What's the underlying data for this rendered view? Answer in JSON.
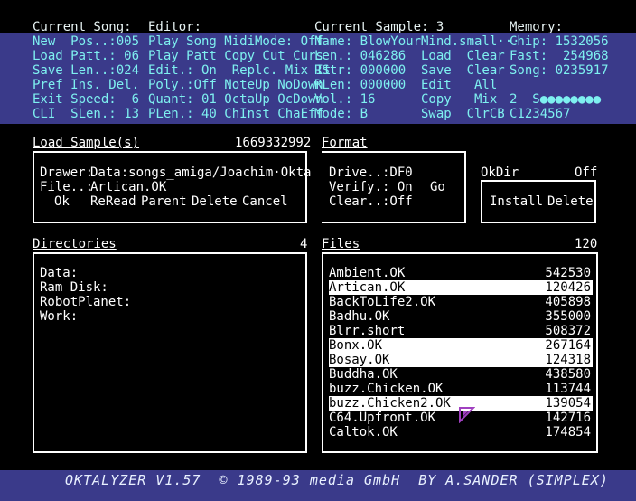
{
  "header": {
    "rows": [
      [
        "Current Song:",
        "Editor:",
        "Current Sample: 3",
        "Memory:"
      ],
      [
        "New  Pos..:005",
        "Play Song MidiMode: Off",
        "Name: BlowYourMind.small···",
        "Chip: 1532056"
      ],
      [
        "Load Patt.: 06",
        "Play Patt Copy Cut Curs",
        "Len.: 046286  Load  Clear",
        "Fast:  254968"
      ],
      [
        "Save Len..:024",
        "Edit.: On  Replc. Mix It",
        "RStr: 000000  Save  Clear",
        "Song: 0235917"
      ],
      [
        "Pref Ins. Del.",
        "Poly.:Off NoteUp NoDown",
        "RLen: 000000  Edit   All",
        ""
      ],
      [
        "Exit Speed:  6",
        "Quant: 01 OctaUp OcDown",
        "Vol.: 16      Copy   Mix",
        "2  S●●●●●●●●"
      ],
      [
        "CLI  SLen.: 13",
        "PLen.: 40 ChInst ChaEff",
        "Mode: B       Swap  ClrCB",
        "C1234567"
      ]
    ]
  },
  "load_sample": {
    "title": "Load Sample(s)",
    "free": "1669332992",
    "drawer_label": "Drawer:",
    "drawer_value": "Data:songs_amiga/Joachim·Okta",
    "file_label": "File..:",
    "file_value": "Artican.OK",
    "buttons": [
      "Ok",
      "ReRead",
      "Parent",
      "Delete",
      "Cancel"
    ]
  },
  "format": {
    "title": "Format",
    "drive": "Drive..:DF0",
    "verify": "Verify.: On",
    "clear": "Clear..:Off",
    "go": "Go"
  },
  "okdir": {
    "label": "OkDir",
    "value": "Off",
    "install": "Install",
    "delete": "Delete"
  },
  "directories": {
    "title": "Directories",
    "count": "4",
    "items": [
      "Data:",
      "Ram Disk:",
      "RobotPlanet:",
      "Work:"
    ]
  },
  "files": {
    "title": "Files",
    "count": "120",
    "items": [
      {
        "name": "Ambient.OK",
        "size": "542530",
        "selected": false
      },
      {
        "name": "Artican.OK",
        "size": "120426",
        "selected": true
      },
      {
        "name": "BackToLife2.OK",
        "size": "405898",
        "selected": false
      },
      {
        "name": "Badhu.OK",
        "size": "355000",
        "selected": false
      },
      {
        "name": "Blrr.short",
        "size": "508372",
        "selected": false
      },
      {
        "name": "Bonx.OK",
        "size": "267164",
        "selected": true
      },
      {
        "name": "Bosay.OK",
        "size": "124318",
        "selected": true
      },
      {
        "name": "Buddha.OK",
        "size": "438580",
        "selected": false
      },
      {
        "name": "buzz.Chicken.OK",
        "size": "113744",
        "selected": false
      },
      {
        "name": "buzz.Chicken2.OK",
        "size": "139054",
        "selected": true
      },
      {
        "name": "C64.Upfront.OK",
        "size": "142716",
        "selected": false
      },
      {
        "name": "Caltok.OK",
        "size": "174854",
        "selected": false
      }
    ]
  },
  "footer": {
    "text": "OKTALYZER V1.57  © 1989-93 media GmbH  BY A.SANDER (SIMPLEX)"
  },
  "colors": {
    "header_bg": "#3a3a8a",
    "header_text": "#7ef0f0",
    "text": "#ffffff",
    "background": "#000000"
  }
}
